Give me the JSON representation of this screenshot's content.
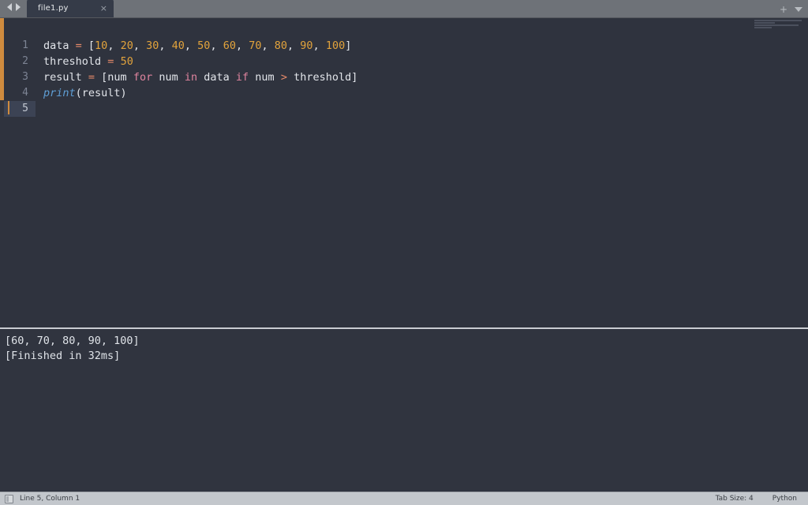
{
  "tabbar": {
    "nav_prev_icon": "arrow-left-icon",
    "nav_next_icon": "arrow-right-icon",
    "tab_label": "file1.py",
    "close_icon": "×",
    "new_tab_icon": "+",
    "dropdown_icon": "chevron-down-icon"
  },
  "editor": {
    "language": "Python",
    "gutter": [
      "1",
      "2",
      "3",
      "4",
      "5"
    ],
    "active_line": 5,
    "lines": [
      {
        "n": 1,
        "tokens": [
          {
            "t": "data ",
            "c": "plain"
          },
          {
            "t": "=",
            "c": "op"
          },
          {
            "t": " [",
            "c": "plain"
          },
          {
            "t": "10",
            "c": "num"
          },
          {
            "t": ", ",
            "c": "plain"
          },
          {
            "t": "20",
            "c": "num"
          },
          {
            "t": ", ",
            "c": "plain"
          },
          {
            "t": "30",
            "c": "num"
          },
          {
            "t": ", ",
            "c": "plain"
          },
          {
            "t": "40",
            "c": "num"
          },
          {
            "t": ", ",
            "c": "plain"
          },
          {
            "t": "50",
            "c": "num"
          },
          {
            "t": ", ",
            "c": "plain"
          },
          {
            "t": "60",
            "c": "num"
          },
          {
            "t": ", ",
            "c": "plain"
          },
          {
            "t": "70",
            "c": "num"
          },
          {
            "t": ", ",
            "c": "plain"
          },
          {
            "t": "80",
            "c": "num"
          },
          {
            "t": ", ",
            "c": "plain"
          },
          {
            "t": "90",
            "c": "num"
          },
          {
            "t": ", ",
            "c": "plain"
          },
          {
            "t": "100",
            "c": "num"
          },
          {
            "t": "]",
            "c": "plain"
          }
        ]
      },
      {
        "n": 2,
        "tokens": [
          {
            "t": "threshold ",
            "c": "plain"
          },
          {
            "t": "=",
            "c": "op"
          },
          {
            "t": " ",
            "c": "plain"
          },
          {
            "t": "50",
            "c": "num"
          }
        ]
      },
      {
        "n": 3,
        "tokens": [
          {
            "t": "result ",
            "c": "plain"
          },
          {
            "t": "=",
            "c": "op"
          },
          {
            "t": " [num ",
            "c": "plain"
          },
          {
            "t": "for",
            "c": "kw"
          },
          {
            "t": " num ",
            "c": "plain"
          },
          {
            "t": "in",
            "c": "kw"
          },
          {
            "t": " data ",
            "c": "plain"
          },
          {
            "t": "if",
            "c": "kw"
          },
          {
            "t": " num ",
            "c": "plain"
          },
          {
            "t": ">",
            "c": "op"
          },
          {
            "t": " threshold]",
            "c": "plain"
          }
        ]
      },
      {
        "n": 4,
        "tokens": [
          {
            "t": "print",
            "c": "fn"
          },
          {
            "t": "(result)",
            "c": "plain"
          }
        ]
      },
      {
        "n": 5,
        "tokens": []
      }
    ]
  },
  "output": {
    "lines": [
      "[60, 70, 80, 90, 100]",
      "[Finished in 32ms]"
    ]
  },
  "statusbar": {
    "panel_icon": "panel-toggle-icon",
    "cursor_position": "Line 5, Column 1",
    "tab_size": "Tab Size: 4",
    "syntax": "Python"
  },
  "colors": {
    "editor_bg": "#2f333e",
    "output_bg": "#30343f",
    "tabbar_bg": "#6e7278",
    "active_tab_bg": "#353b48",
    "statusbar_bg": "#c3c7cc",
    "number": "#e2a33c",
    "operator": "#e88b6a",
    "keyword": "#e0849f",
    "function": "#5f9fd6",
    "plain_text": "#e2e5ea",
    "gutter_text": "#7d8494",
    "caret": "#cf8b3e",
    "fold_marker": "#cf8b3e"
  }
}
